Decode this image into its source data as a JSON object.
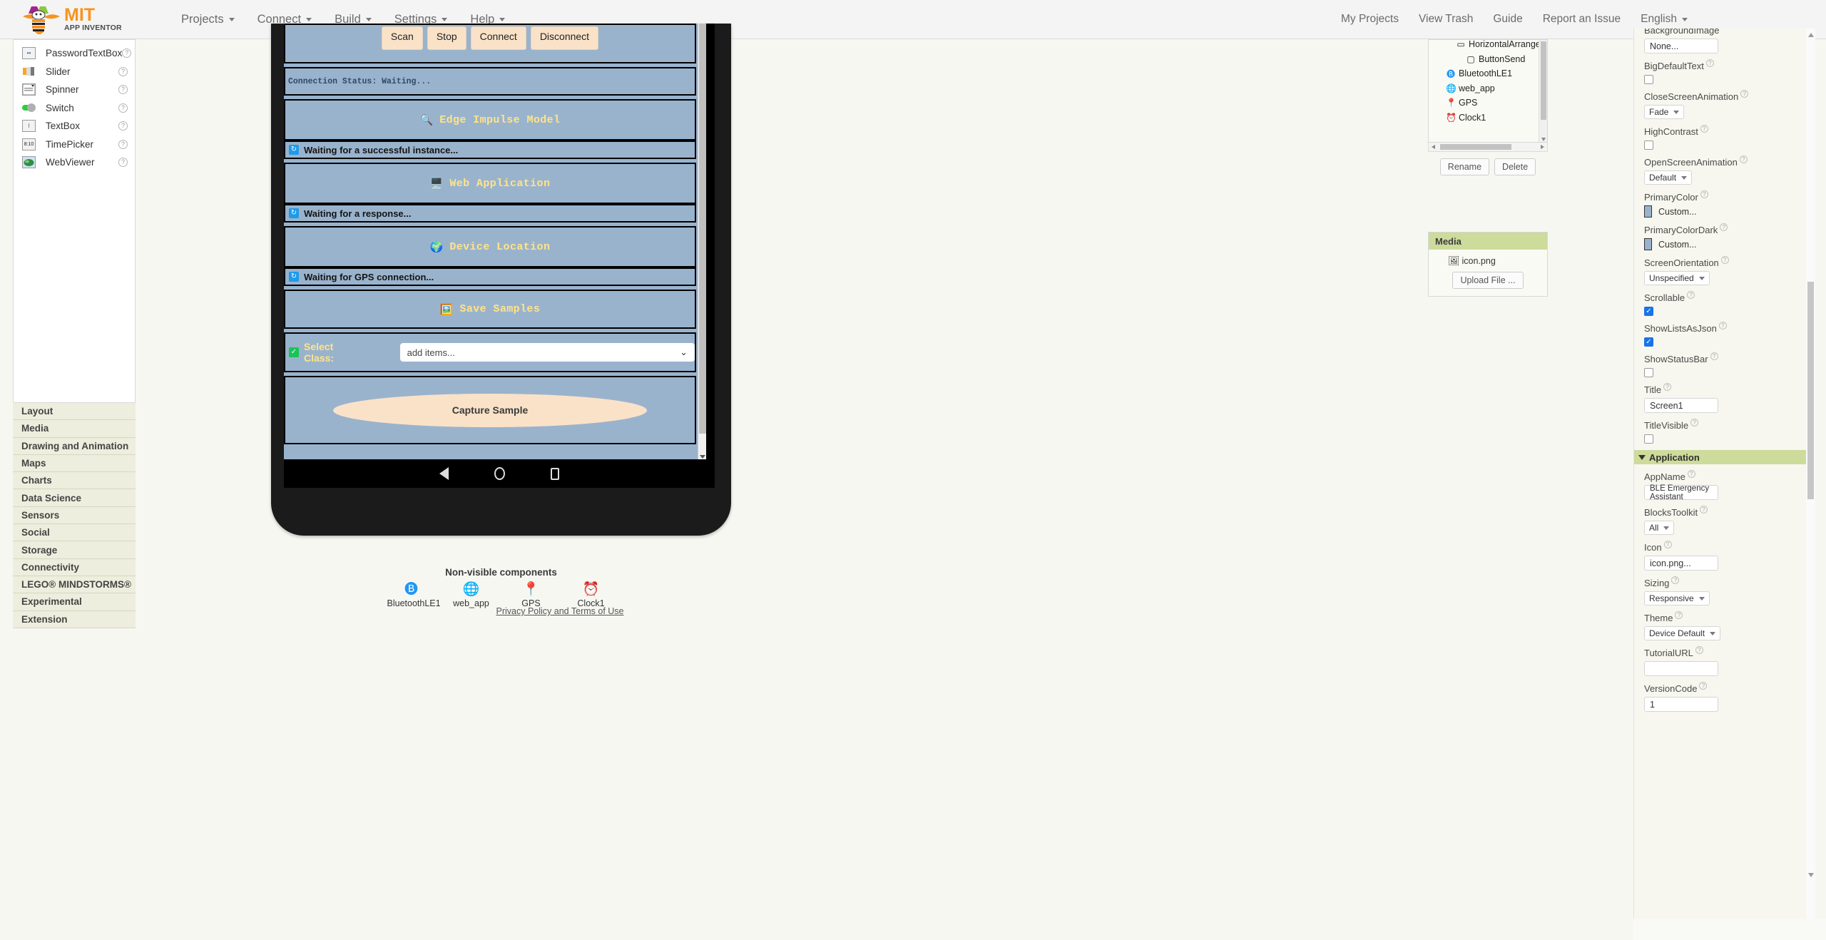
{
  "topbar": {
    "logo_mit": "MIT",
    "logo_app_inventor": "APP INVENTOR",
    "menus": [
      {
        "label": "Projects",
        "caret": "chevron-down-icon"
      },
      {
        "label": "Connect",
        "caret": "chevron-down-icon"
      },
      {
        "label": "Build",
        "caret": "chevron-down-icon"
      },
      {
        "label": "Settings",
        "caret": "chevron-down-icon"
      },
      {
        "label": "Help",
        "caret": "chevron-down-icon"
      }
    ],
    "right_menus": [
      {
        "label": "My Projects",
        "caret": false
      },
      {
        "label": "View Trash",
        "caret": false
      },
      {
        "label": "Guide",
        "caret": false
      },
      {
        "label": "Report an Issue",
        "caret": false
      },
      {
        "label": "English",
        "caret": true
      }
    ]
  },
  "palette": {
    "items": [
      {
        "label": "PasswordTextBox",
        "icon": "password-textbox-icon",
        "help": "?"
      },
      {
        "label": "Slider",
        "icon": "slider-icon",
        "help": "?"
      },
      {
        "label": "Spinner",
        "icon": "spinner-icon",
        "help": "?"
      },
      {
        "label": "Switch",
        "icon": "switch-icon",
        "help": "?"
      },
      {
        "label": "TextBox",
        "icon": "textbox-icon",
        "help": "?"
      },
      {
        "label": "TimePicker",
        "icon": "timepicker-icon",
        "help": "?"
      },
      {
        "label": "WebViewer",
        "icon": "webviewer-icon",
        "help": "?"
      }
    ],
    "categories": [
      "Layout",
      "Media",
      "Drawing and Animation",
      "Maps",
      "Charts",
      "Data Science",
      "Sensors",
      "Social",
      "Storage",
      "Connectivity",
      "LEGO® MINDSTORMS®",
      "Experimental",
      "Extension"
    ]
  },
  "viewer": {
    "ble_buttons": [
      "Scan",
      "Stop",
      "Connect",
      "Disconnect"
    ],
    "connection_status": "Connection Status: Waiting...",
    "sections": [
      {
        "emoji": "🔍",
        "title": "Edge Impulse Model",
        "status": "Waiting for a successful instance...",
        "status_icon": "refresh-icon"
      },
      {
        "emoji": "🖥️",
        "title": "Web Application",
        "status": "Waiting for a response...",
        "status_icon": "refresh-icon"
      },
      {
        "emoji": "🌍",
        "title": "Device Location",
        "status": "Waiting for GPS connection...",
        "status_icon": "refresh-icon"
      },
      {
        "emoji": "🖼️",
        "title": "Save Samples",
        "status": null,
        "status_icon": null
      }
    ],
    "select_class_label": "Select Class:",
    "spinner_value": "add items...",
    "capture_button": "Capture Sample",
    "nav_back": "back-icon",
    "nav_home": "home-icon",
    "nav_recents": "recents-icon",
    "nonvisible_title": "Non-visible components",
    "nonvisible": [
      {
        "label": "BluetoothLE1",
        "icon": "bluetooth-icon"
      },
      {
        "label": "web_app",
        "icon": "globe-icon"
      },
      {
        "label": "GPS",
        "icon": "location-pin-icon"
      },
      {
        "label": "Clock1",
        "icon": "clock-icon"
      }
    ],
    "privacy_link": "Privacy Policy and Terms of Use"
  },
  "components_tree": {
    "rows": [
      {
        "label": "HorizontalArrangem",
        "icon": "horizontal-arrangement-icon",
        "indent": 38
      },
      {
        "label": "ButtonSend",
        "icon": "button-icon",
        "indent": 52
      },
      {
        "label": "BluetoothLE1",
        "icon": "bluetooth-icon",
        "indent": 24
      },
      {
        "label": "web_app",
        "icon": "globe-icon",
        "indent": 24
      },
      {
        "label": "GPS",
        "icon": "location-pin-icon",
        "indent": 24
      },
      {
        "label": "Clock1",
        "icon": "clock-icon",
        "indent": 24
      }
    ],
    "rename_label": "Rename",
    "delete_label": "Delete"
  },
  "media": {
    "header": "Media",
    "files": [
      {
        "label": "icon.png",
        "icon": "image-icon"
      }
    ],
    "upload_label": "Upload File ..."
  },
  "properties": {
    "items": [
      {
        "name": "BackgroundImage",
        "type": "text",
        "value": "None...",
        "help": false,
        "clipped": true
      },
      {
        "name": "BigDefaultText",
        "type": "checkbox",
        "value": false,
        "help": true
      },
      {
        "name": "CloseScreenAnimation",
        "type": "select",
        "value": "Fade",
        "help": true
      },
      {
        "name": "HighContrast",
        "type": "checkbox",
        "value": false,
        "help": true
      },
      {
        "name": "OpenScreenAnimation",
        "type": "select",
        "value": "Default",
        "help": true
      },
      {
        "name": "PrimaryColor",
        "type": "color",
        "value": "Custom...",
        "swatch": "#9ab3cd",
        "help": true
      },
      {
        "name": "PrimaryColorDark",
        "type": "color",
        "value": "Custom...",
        "swatch": "#9ab3cd",
        "help": true
      },
      {
        "name": "ScreenOrientation",
        "type": "select",
        "value": "Unspecified",
        "help": true
      },
      {
        "name": "Scrollable",
        "type": "checkbox",
        "value": true,
        "help": true
      },
      {
        "name": "ShowListsAsJson",
        "type": "checkbox",
        "value": true,
        "help": true
      },
      {
        "name": "ShowStatusBar",
        "type": "checkbox",
        "value": false,
        "help": true
      },
      {
        "name": "Title",
        "type": "text",
        "value": "Screen1",
        "help": true
      },
      {
        "name": "TitleVisible",
        "type": "checkbox",
        "value": false,
        "help": true
      }
    ],
    "application_section": "Application",
    "app_items": [
      {
        "name": "AppName",
        "type": "text",
        "value": "BLE Emergency Assistant",
        "help": true
      },
      {
        "name": "BlocksToolkit",
        "type": "select",
        "value": "All",
        "help": true
      },
      {
        "name": "Icon",
        "type": "text",
        "value": "icon.png...",
        "help": true
      },
      {
        "name": "Sizing",
        "type": "select",
        "value": "Responsive",
        "help": true
      },
      {
        "name": "Theme",
        "type": "select",
        "value": "Device Default",
        "help": true
      },
      {
        "name": "TutorialURL",
        "type": "text",
        "value": "",
        "help": true
      },
      {
        "name": "VersionCode",
        "type": "text",
        "value": "1",
        "help": true
      }
    ]
  }
}
